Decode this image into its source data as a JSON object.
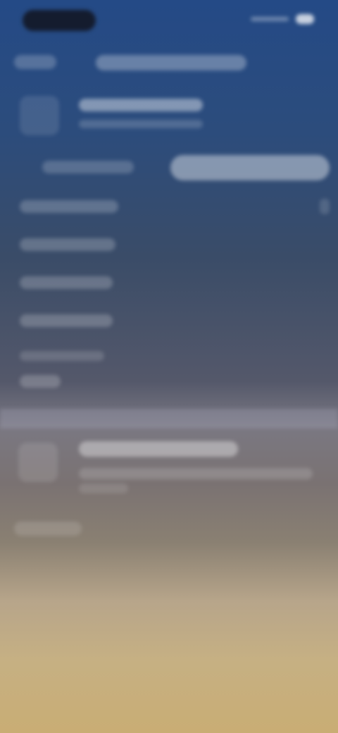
{
  "status_bar": {
    "time": "",
    "icons": [
      "signal-icon",
      "battery-icon"
    ]
  },
  "nav": {
    "back_label": "",
    "title": ""
  },
  "header": {
    "title": "",
    "subtitle": ""
  },
  "segmented": {
    "left_label": "",
    "right_label": ""
  },
  "list": {
    "items": [
      {
        "label": ""
      },
      {
        "label": ""
      },
      {
        "label": ""
      },
      {
        "label": ""
      },
      {
        "label": ""
      },
      {
        "label": ""
      }
    ]
  },
  "card": {
    "title": "",
    "description": "",
    "meta": ""
  },
  "footer": {
    "link_label": ""
  },
  "colors": {
    "top": "#244a86",
    "middle": "#54586a",
    "bottom": "#c9ad74"
  }
}
